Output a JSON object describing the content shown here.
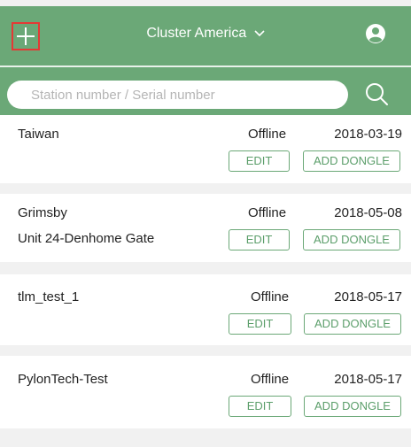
{
  "header": {
    "cluster_label": "Cluster America"
  },
  "search": {
    "placeholder": "Station number / Serial number"
  },
  "stations": [
    {
      "name": "Taiwan",
      "address": "",
      "status": "Offline",
      "date": "2018-03-19",
      "edit_label": "EDIT",
      "dongle_label": "ADD DONGLE"
    },
    {
      "name": "Grimsby",
      "address": "Unit 24-Denhome Gate",
      "status": "Offline",
      "date": "2018-05-08",
      "edit_label": "EDIT",
      "dongle_label": "ADD DONGLE"
    },
    {
      "name": "tlm_test_1",
      "address": "",
      "status": "Offline",
      "date": "2018-05-17",
      "edit_label": "EDIT",
      "dongle_label": "ADD DONGLE"
    },
    {
      "name": "PylonTech-Test",
      "address": "",
      "status": "Offline",
      "date": "2018-05-17",
      "edit_label": "EDIT",
      "dongle_label": "ADD DONGLE"
    }
  ],
  "colors": {
    "brand": "#6ba877",
    "highlight_border": "#e53935",
    "background": "#f1f1f1"
  },
  "icons": [
    "plus-icon",
    "chevron-down-icon",
    "user-icon",
    "search-icon"
  ]
}
